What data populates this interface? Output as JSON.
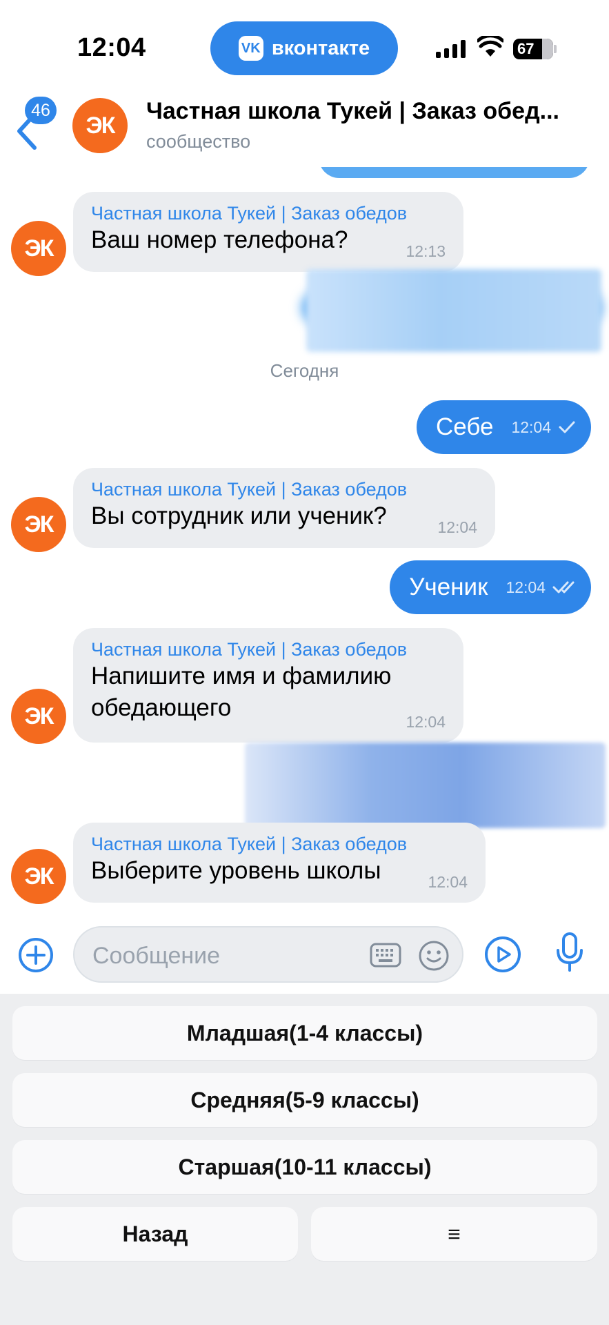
{
  "status_bar": {
    "time": "12:04",
    "app_pill": "вконтакте",
    "app_logo": "vk",
    "battery": "67"
  },
  "header": {
    "badge_count": "46",
    "title": "Частная школа Тукей | Заказ обед...",
    "subtitle": "сообщество",
    "avatar_text": "ЭК"
  },
  "chat": {
    "messages": [
      {
        "sender": "Частная школа Тукей | Заказ обедов",
        "text": "Ваш номер телефона?",
        "time": "12:13"
      },
      {
        "sender": "Частная школа Тукей | Заказ обедов",
        "text": "Вы сотрудник или ученик?",
        "time": "12:04"
      },
      {
        "sender": "Частная школа Тукей | Заказ обедов",
        "text": "Напишите имя и фамилию обедающего",
        "time": "12:04"
      },
      {
        "sender": "Частная школа Тукей | Заказ обедов",
        "text": "Выберите уровень школы",
        "time": "12:04"
      }
    ],
    "outgoing": [
      {
        "text": "Себе",
        "time": "12:04",
        "status": "sent-check-icon"
      },
      {
        "text": "Ученик",
        "time": "12:04",
        "status": "read-double-check-icon"
      }
    ],
    "date_separator": "Сегодня"
  },
  "input": {
    "placeholder": "Сообщение"
  },
  "keyboard": {
    "buttons": [
      "Младшая(1-4 классы)",
      "Средняя(5-9 классы)",
      "Старшая(10-11 классы)"
    ],
    "back": "Назад",
    "menu": "≡"
  },
  "colors": {
    "accent": "#2f86e9",
    "avatar": "#f46a1e",
    "bubble_in": "#ebedf0",
    "keyboard_bg": "#edeef0"
  }
}
